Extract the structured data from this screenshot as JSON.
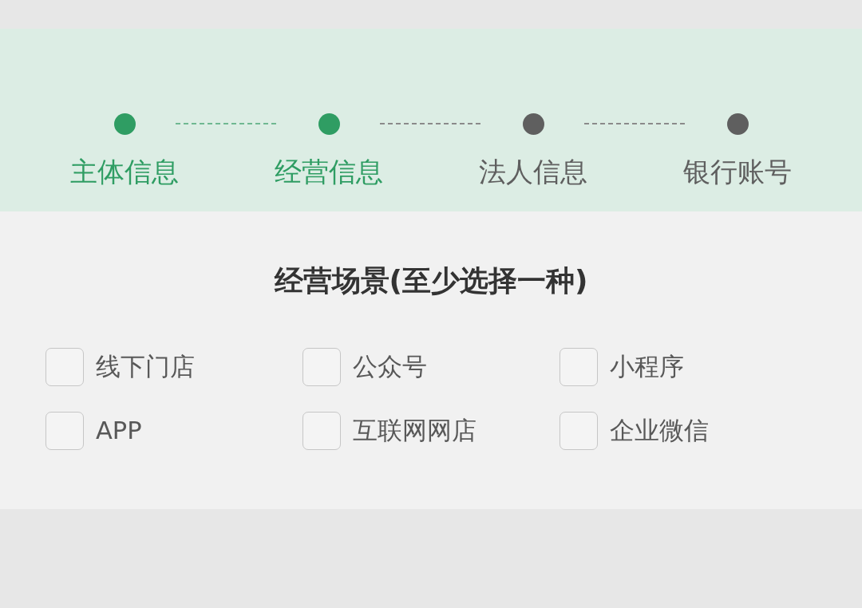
{
  "stepper": {
    "steps": [
      {
        "label": "主体信息",
        "done": true
      },
      {
        "label": "经营信息",
        "done": true
      },
      {
        "label": "法人信息",
        "done": false
      },
      {
        "label": "银行账号",
        "done": false
      }
    ]
  },
  "scenes": {
    "title": "经营场景(至少选择一种)",
    "options": [
      {
        "label": "线下门店",
        "checked": false
      },
      {
        "label": "公众号",
        "checked": false
      },
      {
        "label": "小程序",
        "checked": false
      },
      {
        "label": "APP",
        "checked": false
      },
      {
        "label": "互联网网店",
        "checked": false
      },
      {
        "label": "企业微信",
        "checked": false
      }
    ]
  }
}
